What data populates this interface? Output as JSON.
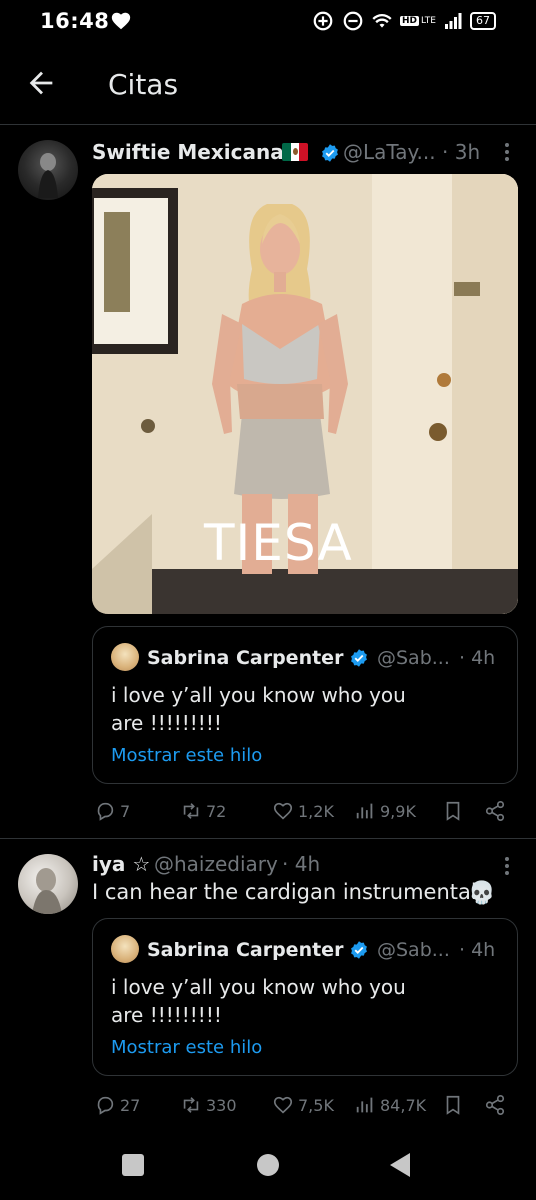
{
  "status_bar": {
    "time": "16:48",
    "battery": "67",
    "network": "LTE",
    "hd": "HD"
  },
  "header": {
    "title": "Citas"
  },
  "posts": [
    {
      "name": "Swiftie Mexicana",
      "flag": "🇲🇽",
      "handle": "@LaTay...",
      "time": "· 3h",
      "image_caption": "TIESA",
      "quote": {
        "name": "Sabrina Carpenter",
        "handle": "@Sab...",
        "time": "· 4h",
        "text_line1": "i love y’all you know who you",
        "text_line2": "are !!!!!!!!!",
        "show_thread": "Mostrar este hilo"
      },
      "stats": {
        "replies": "7",
        "retweets": "72",
        "likes": "1,2K",
        "views": "9,9K"
      }
    },
    {
      "name": "iya ☆",
      "handle": "@haizediary",
      "time": "· 4h",
      "text": "I can hear the cardigan instrumental",
      "emoji": "💀",
      "quote": {
        "name": "Sabrina Carpenter",
        "handle": "@Sab...",
        "time": "· 4h",
        "text_line1": "i love y’all you know who you",
        "text_line2": "are !!!!!!!!!",
        "show_thread": "Mostrar este hilo"
      },
      "stats": {
        "replies": "27",
        "retweets": "330",
        "likes": "7,5K",
        "views": "84,7K"
      }
    }
  ],
  "colors": {
    "background": "#000000",
    "text": "#e7e9ea",
    "muted": "#71767b",
    "link": "#1d9bf0",
    "verified": "#1d9bf0",
    "border": "#2f3336"
  },
  "icons": [
    "back-arrow-icon",
    "heart-icon",
    "verified-icon",
    "more-icon",
    "reply-icon",
    "retweet-icon",
    "like-icon",
    "views-icon",
    "bookmark-icon",
    "share-icon"
  ]
}
